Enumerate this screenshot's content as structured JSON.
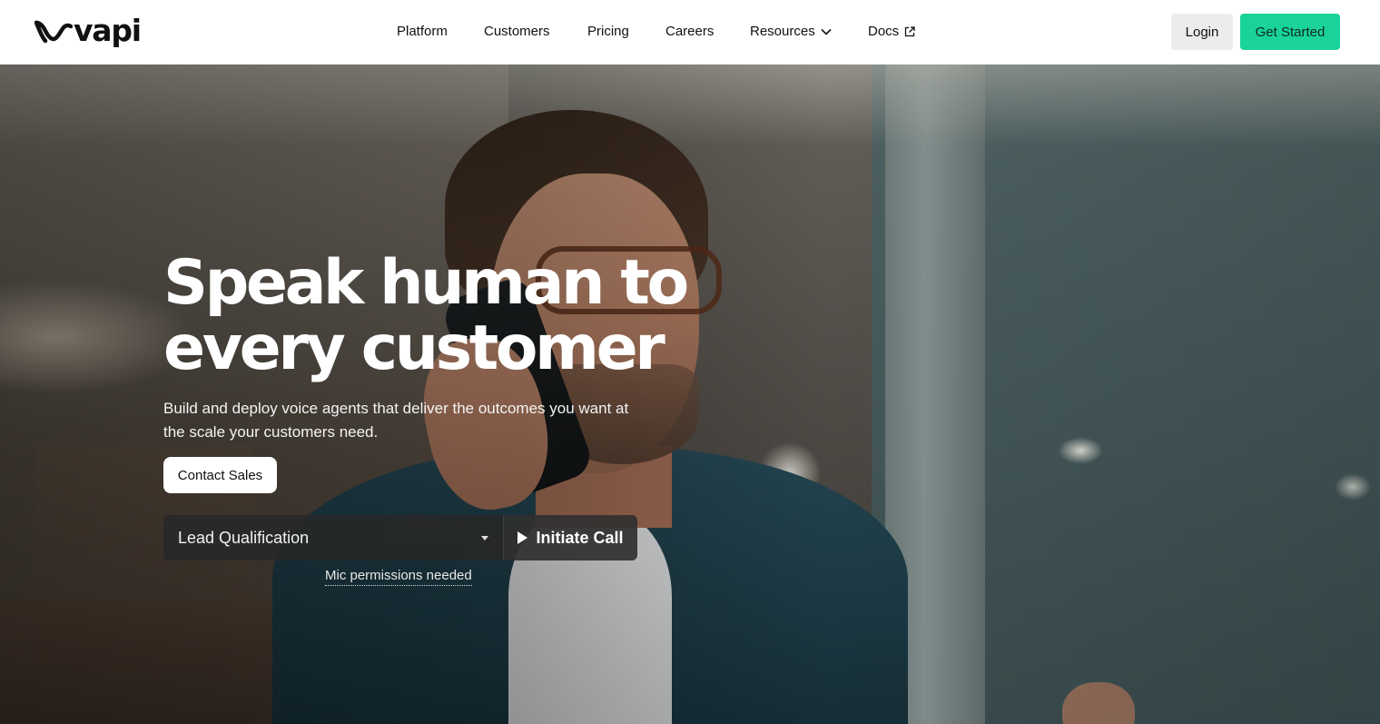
{
  "header": {
    "logo_text": "vapi",
    "nav": [
      {
        "label": "Platform"
      },
      {
        "label": "Customers"
      },
      {
        "label": "Pricing"
      },
      {
        "label": "Careers"
      },
      {
        "label": "Resources",
        "icon": "chevron-down-icon"
      },
      {
        "label": "Docs",
        "icon": "external-link-icon"
      }
    ],
    "login_label": "Login",
    "get_started_label": "Get Started",
    "accent_color": "#19d39b"
  },
  "hero": {
    "title_line1": "Speak human to",
    "title_line2": "every customer",
    "subtitle": "Build and deploy voice agents that deliver the outcomes you want at the scale your customers need.",
    "contact_label": "Contact Sales",
    "demo_select_value": "Lead Qualification",
    "initiate_call_label": "Initiate Call",
    "mic_note": "Mic permissions needed"
  }
}
